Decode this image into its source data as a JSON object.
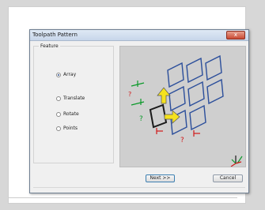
{
  "dialog": {
    "title": "Toolpath Pattern",
    "close_symbol": "x"
  },
  "feature": {
    "legend": "Feature",
    "options": [
      {
        "label": "Array",
        "checked": true
      },
      {
        "label": "Translate",
        "checked": false
      },
      {
        "label": "Rotate",
        "checked": false
      },
      {
        "label": "Points",
        "checked": false
      }
    ]
  },
  "preview": {
    "marks": [
      "?",
      "?",
      "?"
    ],
    "icons": [
      "pattern-grid-illustration",
      "arrow-right-icon",
      "arrow-up-icon",
      "axis-triad-icon"
    ],
    "colors": {
      "background": "#cfcfcf",
      "grid": "#2c4f9b",
      "selected": "#1a1a1a",
      "arrow_fill": "#f5e21e",
      "dimension": "#d01818",
      "axis_green": "#0b9a2a"
    }
  },
  "buttons": {
    "next": "Next >>",
    "cancel": "Cancel"
  }
}
